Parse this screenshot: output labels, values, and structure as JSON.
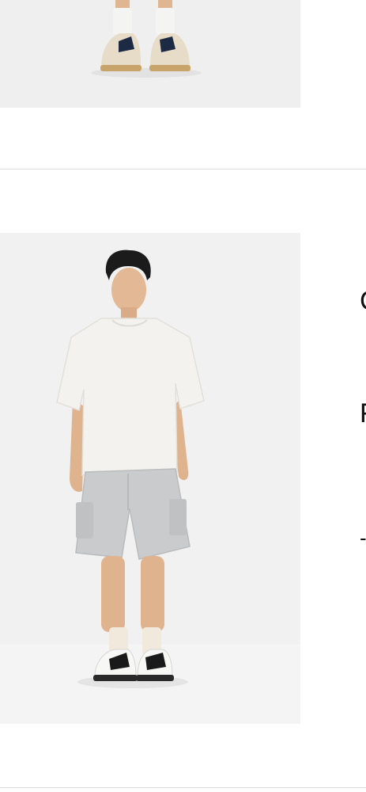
{
  "products": [
    {
      "image": {
        "alt": "",
        "icon": "product-photo"
      },
      "name": "",
      "price": "",
      "extra": ""
    },
    {
      "image": {
        "alt": "",
        "icon": "product-photo"
      },
      "name": "C",
      "price": "F",
      "extra": "-"
    }
  ],
  "colors": {
    "background": "#ffffff",
    "image_background": "#efefef",
    "divider": "#dcdcdc",
    "text": "#111111",
    "tshirt": "#f3f2ee",
    "shorts": "#c9cbcc",
    "socks": "#f0e9dc",
    "skin": "#e3b895",
    "hair": "#1b1b1b"
  }
}
